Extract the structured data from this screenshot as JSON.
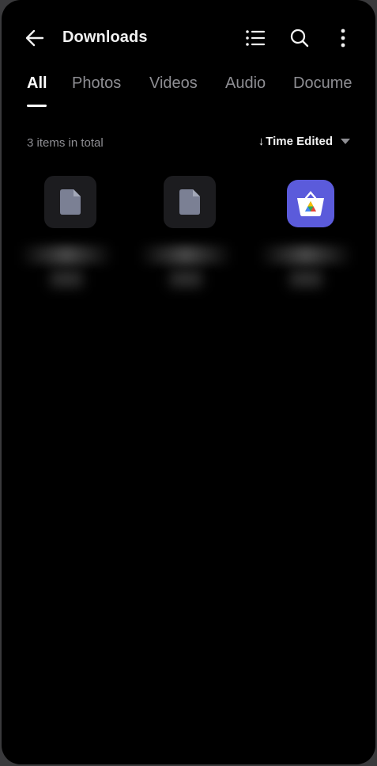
{
  "header": {
    "title": "Downloads"
  },
  "tabs": [
    {
      "label": "All"
    },
    {
      "label": "Photos"
    },
    {
      "label": "Videos"
    },
    {
      "label": "Audio"
    },
    {
      "label": "Docume"
    }
  ],
  "summary": {
    "count_text": "3 items in total",
    "sort_arrow": "↓",
    "sort_label": "Time Edited",
    "sort_caret": "▼"
  },
  "files": [
    {
      "icon": "document-icon",
      "name": ""
    },
    {
      "icon": "document-icon",
      "name": ""
    },
    {
      "icon": "app-store-icon",
      "name": ""
    }
  ],
  "colors": {
    "background": "#000000",
    "text_primary": "#ffffff",
    "text_secondary": "#8e8e93",
    "thumb_bg": "#1c1c1f",
    "doc_icon": "#7b8094",
    "app_icon_bg": "#5b5bdb"
  }
}
